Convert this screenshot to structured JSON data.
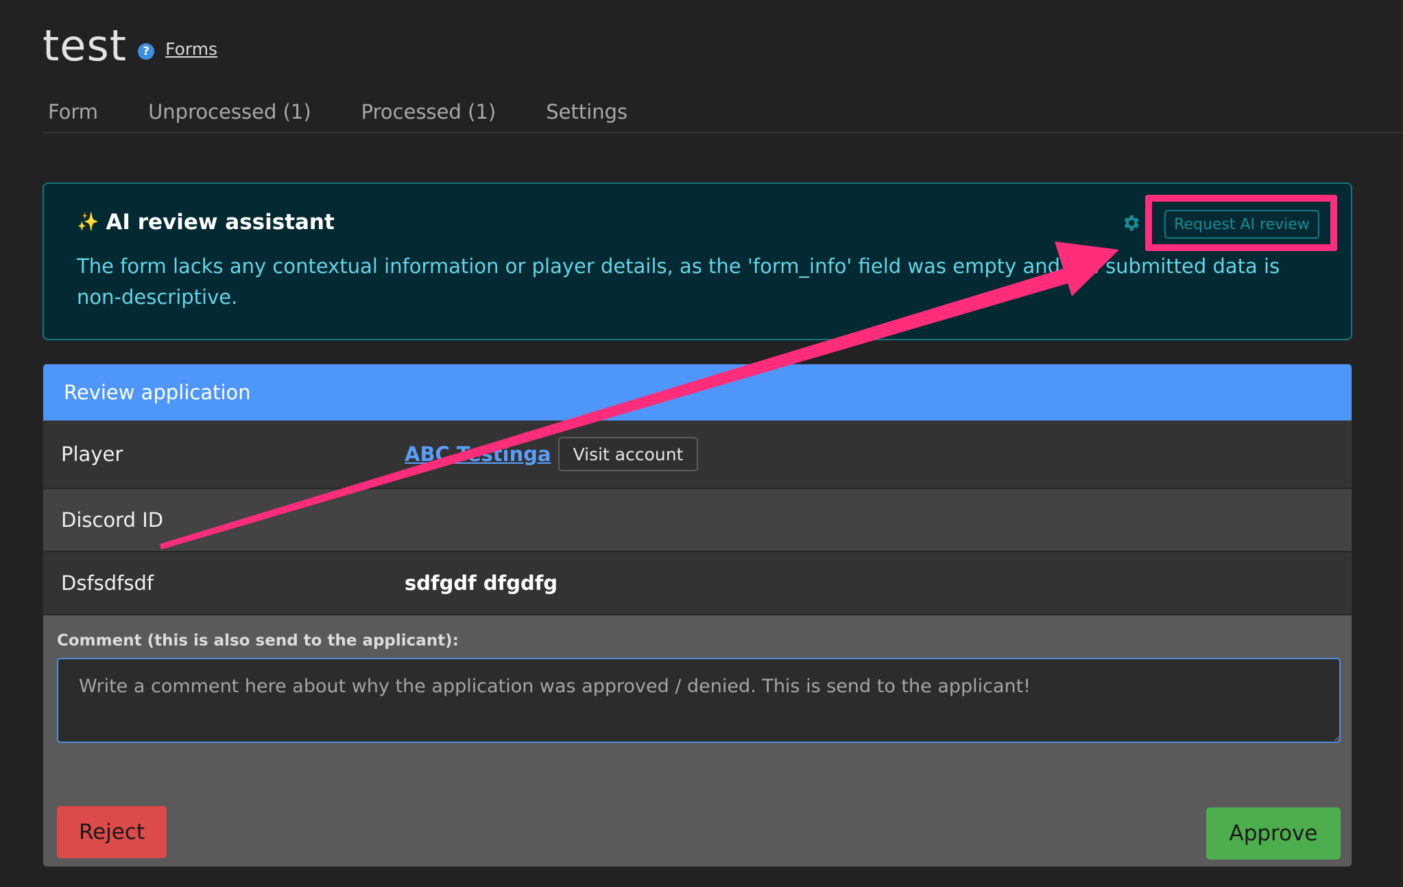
{
  "header": {
    "title": "test",
    "help_icon": "question-circle-icon",
    "forms_link": "Forms"
  },
  "tabs": [
    {
      "label": "Form"
    },
    {
      "label": "Unprocessed (1)"
    },
    {
      "label": "Processed (1)"
    },
    {
      "label": "Settings"
    }
  ],
  "ai_review": {
    "icon": "sparkle-icon",
    "title": "AI review assistant",
    "text": "The form lacks any contextual information or player details, as the 'form_info' field was empty and the submitted data is non-descriptive.",
    "settings_icon": "gear-icon",
    "request_button": "Request AI review"
  },
  "review": {
    "header": "Review application",
    "rows": [
      {
        "label": "Player",
        "link": "ABC Testinga",
        "button": "Visit account"
      },
      {
        "label": "Discord ID",
        "value": ""
      },
      {
        "label": "Dsfsdfsdf",
        "value": "sdfgdf dfgdfg"
      }
    ],
    "comment_label": "Comment (this is also send to the applicant):",
    "comment_value": "",
    "comment_placeholder": "Write a comment here about why the application was approved / denied. This is send to the applicant!",
    "reject_label": "Reject",
    "approve_label": "Approve"
  },
  "colors": {
    "accent_blue": "#4e96fa",
    "ai_border": "#13777f",
    "ai_text": "#66d4e6",
    "reject": "#dc4a4a",
    "approve": "#4cae4c",
    "annotation": "#ff2d7a"
  }
}
